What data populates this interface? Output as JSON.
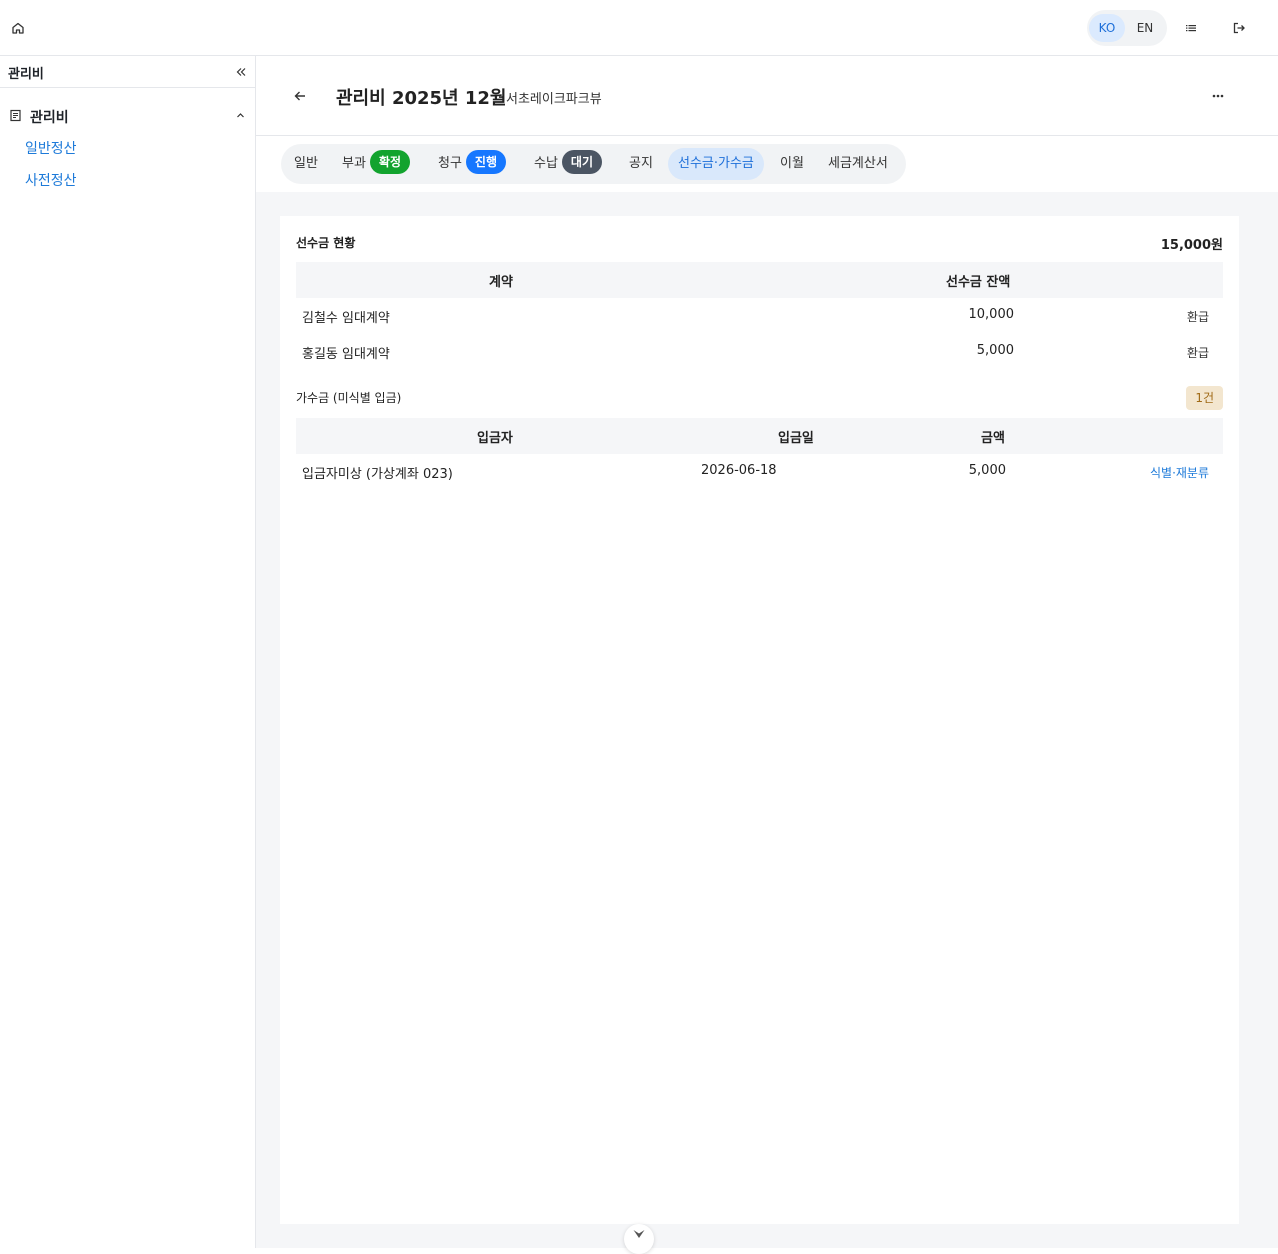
{
  "header": {
    "lang_ko": "KO",
    "lang_en": "EN",
    "active_lang": "KO",
    "icons": [
      "home-icon",
      "list-icon",
      "logout-icon"
    ]
  },
  "sidebar": {
    "title": "관리비",
    "group_label": "관리비",
    "items": [
      {
        "label": "일반정산"
      },
      {
        "label": "사전정산"
      }
    ]
  },
  "page": {
    "title": "관리비 2025년 12월",
    "subtitle": "서초레이크파크뷰"
  },
  "tabs": [
    {
      "label": "일반"
    },
    {
      "label": "부과",
      "badge": "확정",
      "badge_color": "#12a32e"
    },
    {
      "label": "청구",
      "badge": "진행",
      "badge_color": "#1677ff"
    },
    {
      "label": "수납",
      "badge": "대기",
      "badge_color": "#4b5563"
    },
    {
      "label": "공지"
    },
    {
      "label": "선수금·가수금",
      "active": true
    },
    {
      "label": "이월"
    },
    {
      "label": "세금계산서"
    }
  ],
  "prepaid": {
    "title": "선수금 현황",
    "total": "15,000원",
    "columns": [
      "계약",
      "선수금 잔액"
    ],
    "rows": [
      {
        "contract": "김철수 임대계약",
        "balance": "10,000",
        "action": "환급"
      },
      {
        "contract": "홍길동 임대계약",
        "balance": "5,000",
        "action": "환급"
      }
    ]
  },
  "suspense": {
    "title": "가수금 (미식별 입금)",
    "count": "1건",
    "columns": [
      "입금자",
      "입금일",
      "금액"
    ],
    "rows": [
      {
        "depositor": "입금자미상 (가상계좌 023)",
        "date": "2026-06-18",
        "amount": "5,000",
        "action": "식별·재분류"
      }
    ]
  },
  "colors": {
    "accent": "#1d7ad9",
    "active_tab_bg": "#d9e8fb"
  }
}
